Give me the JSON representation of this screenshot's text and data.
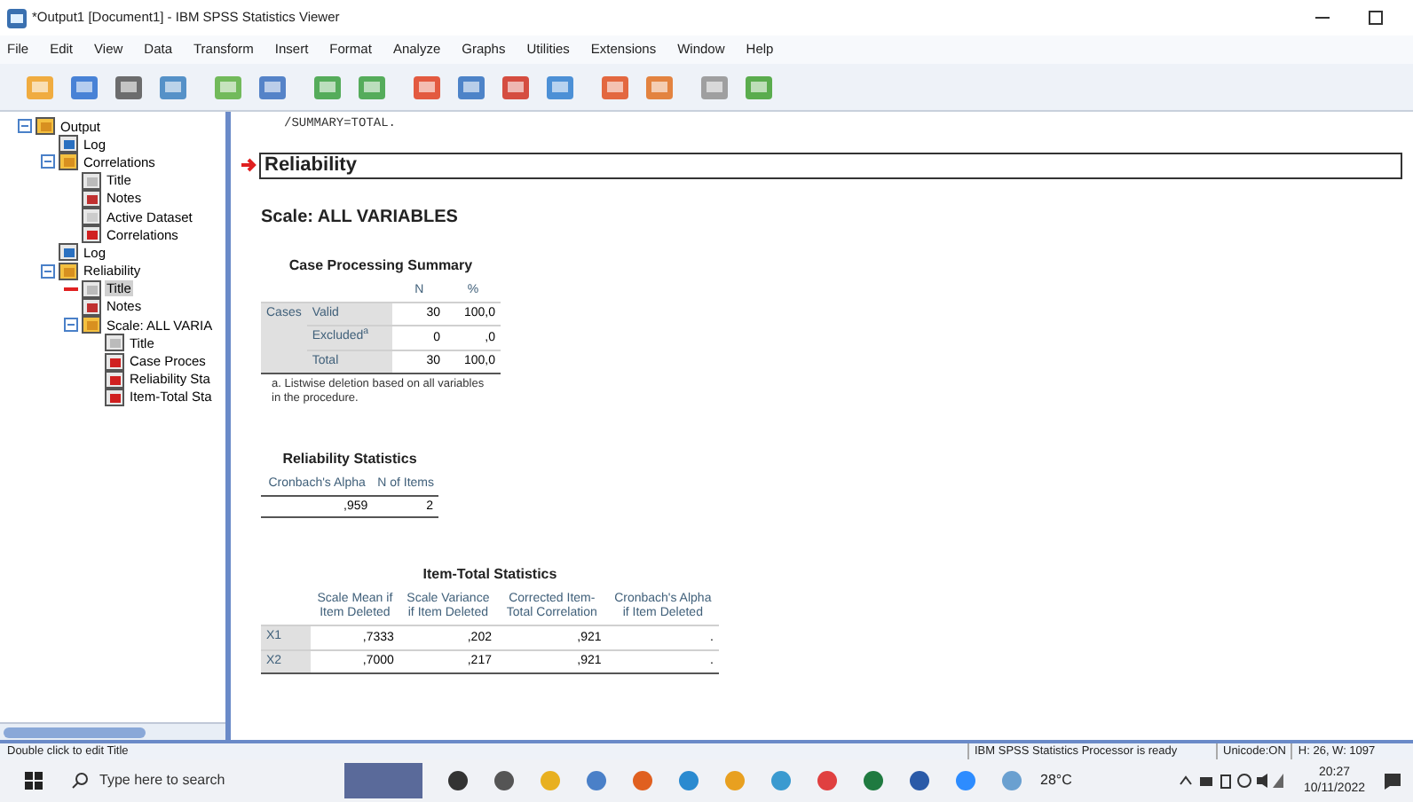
{
  "window": {
    "title": "*Output1 [Document1] - IBM SPSS Statistics Viewer"
  },
  "menu": [
    "File",
    "Edit",
    "View",
    "Data",
    "Transform",
    "Insert",
    "Format",
    "Analyze",
    "Graphs",
    "Utilities",
    "Extensions",
    "Window",
    "Help"
  ],
  "outline": [
    {
      "label": "Output",
      "kind": "book",
      "expanded": true,
      "selected": false,
      "children": [
        {
          "label": "Log",
          "kind": "log",
          "selected": false
        },
        {
          "label": "Correlations",
          "kind": "book",
          "expanded": true,
          "selected": false,
          "children": [
            {
              "label": "Title",
              "kind": "title",
              "selected": false
            },
            {
              "label": "Notes",
              "kind": "notes",
              "selected": false
            },
            {
              "label": "Active Dataset",
              "kind": "dataset",
              "selected": false
            },
            {
              "label": "Correlations",
              "kind": "table",
              "selected": false
            }
          ]
        },
        {
          "label": "Log",
          "kind": "log",
          "selected": false
        },
        {
          "label": "Reliability",
          "kind": "book",
          "expanded": true,
          "selected": false,
          "children": [
            {
              "label": "Title",
              "kind": "title",
              "selected": true
            },
            {
              "label": "Notes",
              "kind": "notes",
              "selected": false
            },
            {
              "label": "Scale: ALL VARIA",
              "kind": "book",
              "expanded": true,
              "selected": false,
              "children": [
                {
                  "label": "Title",
                  "kind": "title",
                  "selected": false
                },
                {
                  "label": "Case Proces",
                  "kind": "table",
                  "selected": false
                },
                {
                  "label": "Reliability Sta",
                  "kind": "table",
                  "selected": false
                },
                {
                  "label": "Item-Total Sta",
                  "kind": "table",
                  "selected": false
                }
              ]
            }
          ]
        }
      ]
    }
  ],
  "syntax_tail": "/SUMMARY=TOTAL.",
  "heading": "Reliability",
  "scale_title": "Scale: ALL VARIABLES",
  "case_summary": {
    "title": "Case Processing Summary",
    "columns": [
      "N",
      "%"
    ],
    "group": "Cases",
    "rows": [
      {
        "label": "Valid",
        "cells": [
          "30",
          "100,0"
        ]
      },
      {
        "label": "Excluded$^{a}$",
        "cells": [
          "0",
          ",0"
        ]
      },
      {
        "label": "Total",
        "cells": [
          "30",
          "100,0"
        ]
      }
    ],
    "footnote": "a. Listwise deletion based on all variables in the procedure."
  },
  "reliability_stats": {
    "title": "Reliability Statistics",
    "columns": [
      "Cronbach's Alpha",
      "N of Items"
    ],
    "rows": [
      [
        ",959",
        "2"
      ]
    ]
  },
  "item_total": {
    "title": "Item-Total Statistics",
    "columns": [
      "Scale Mean if Item Deleted",
      "Scale Variance if Item Deleted",
      "Corrected Item-Total Correlation",
      "Cronbach's Alpha if Item Deleted"
    ],
    "rows": [
      {
        "label": "X1",
        "cells": [
          ",7333",
          ",202",
          ",921",
          "."
        ]
      },
      {
        "label": "X2",
        "cells": [
          ",7000",
          ",217",
          ",921",
          "."
        ]
      }
    ]
  },
  "status_bar": [
    "Double click to edit Title",
    "IBM SPSS Statistics Processor is ready",
    "Unicode:ON",
    "H: 26, W: 1097"
  ],
  "taskbar": {
    "search_placeholder": "Type here to search",
    "weather": "28°C",
    "time": "20:27",
    "date": "10/11/2022"
  }
}
